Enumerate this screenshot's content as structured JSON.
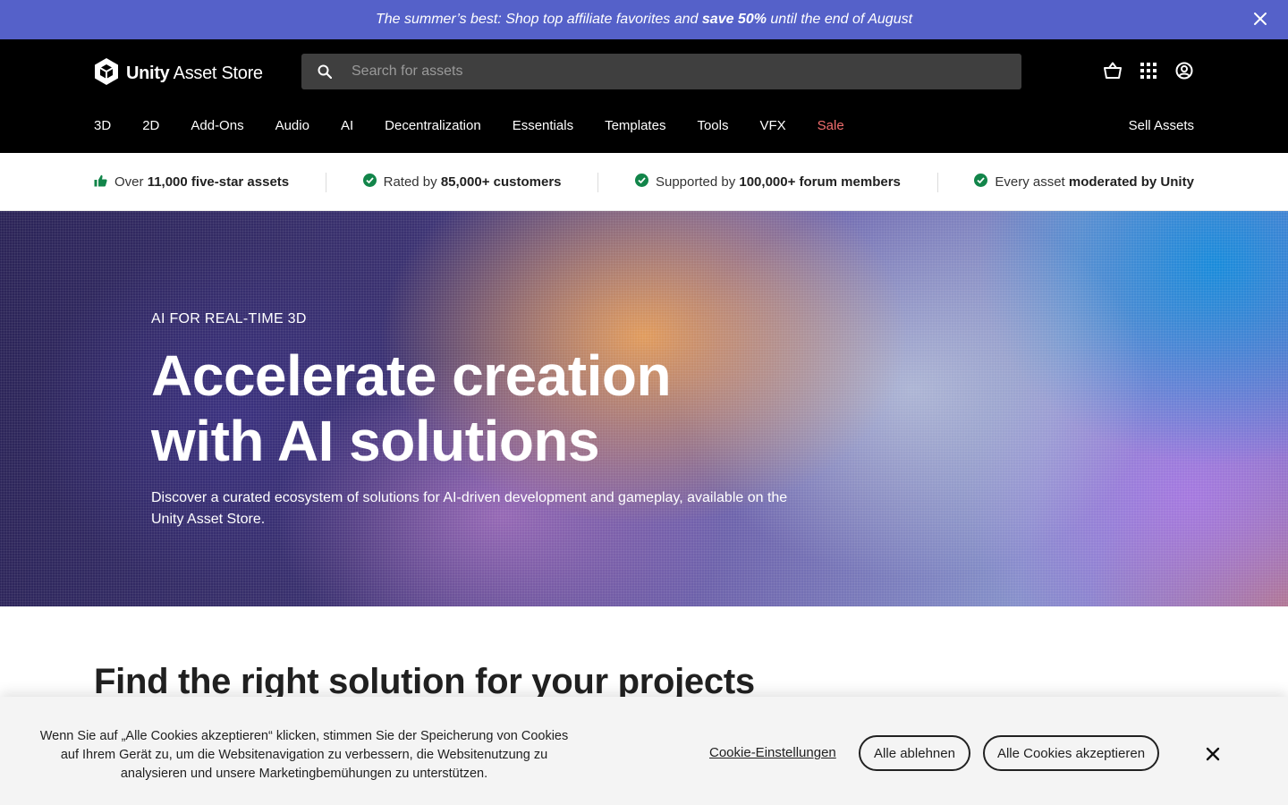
{
  "promo": {
    "text_before": "The summer’s best: Shop top affiliate favorites and ",
    "text_bold": "save 50%",
    "text_after": " until the end of August"
  },
  "header": {
    "logo_bold": "Unity",
    "logo_rest": " Asset Store",
    "search_placeholder": "Search for assets",
    "nav": [
      "3D",
      "2D",
      "Add-Ons",
      "Audio",
      "AI",
      "Decentralization",
      "Essentials",
      "Templates",
      "Tools",
      "VFX",
      "Sale"
    ],
    "sell_label": "Sell Assets"
  },
  "trust": [
    {
      "pre": "Over ",
      "bold": "11,000 five-star assets",
      "post": ""
    },
    {
      "pre": "Rated by ",
      "bold": "85,000+ customers",
      "post": ""
    },
    {
      "pre": "Supported by ",
      "bold": "100,000+ forum members",
      "post": ""
    },
    {
      "pre": "Every asset ",
      "bold": "moderated by Unity",
      "post": ""
    }
  ],
  "hero": {
    "eyebrow": "AI FOR REAL-TIME 3D",
    "title_line1": "Accelerate creation",
    "title_line2": "with AI solutions",
    "description": "Discover a curated ecosystem of solutions for AI-driven development and gameplay, available on the Unity Asset Store."
  },
  "section": {
    "title": "Find the right solution for your projects"
  },
  "cookie": {
    "text": "Wenn Sie auf „Alle Cookies akzeptieren“ klicken, stimmen Sie der Speicherung von Cookies auf Ihrem Gerät zu, um die Websitenavigation zu verbessern, die Websitenutzung zu analysieren und unsere Marketingbemühungen zu unterstützen.",
    "settings_label": "Cookie-Einstellungen",
    "reject_label": "Alle ablehnen",
    "accept_label": "Alle Cookies akzeptieren"
  },
  "colors": {
    "promo_bg": "#5561c9",
    "header_bg": "#000000",
    "sale": "#f26e6e",
    "check_green": "#12854a"
  },
  "icons": [
    "close-icon",
    "unity-logo-icon",
    "search-icon",
    "cart-icon",
    "apps-grid-icon",
    "account-icon",
    "thumbs-up-icon",
    "check-circle-icon"
  ]
}
